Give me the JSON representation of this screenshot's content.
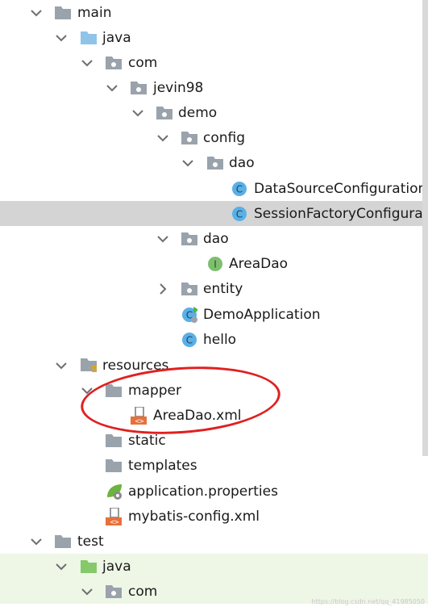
{
  "tree": {
    "nodes": [
      {
        "label": "main",
        "icon": "folder-icon",
        "expanded": true
      },
      {
        "label": "java",
        "icon": "source-folder-icon",
        "expanded": true
      },
      {
        "label": "com",
        "icon": "package-icon",
        "expanded": true
      },
      {
        "label": "jevin98",
        "icon": "package-icon",
        "expanded": true
      },
      {
        "label": "demo",
        "icon": "package-icon",
        "expanded": true
      },
      {
        "label": "config",
        "icon": "package-icon",
        "expanded": true
      },
      {
        "label": "dao",
        "icon": "package-icon",
        "expanded": true
      },
      {
        "label": "DataSourceConfiguration",
        "icon": "class-icon"
      },
      {
        "label": "SessionFactoryConfigurati",
        "icon": "class-icon",
        "selected": true
      },
      {
        "label": "dao",
        "icon": "package-icon",
        "expanded": true
      },
      {
        "label": "AreaDao",
        "icon": "interface-icon"
      },
      {
        "label": "entity",
        "icon": "package-icon",
        "expanded": false
      },
      {
        "label": "DemoApplication",
        "icon": "spring-boot-class-icon"
      },
      {
        "label": "hello",
        "icon": "class-icon"
      },
      {
        "label": "resources",
        "icon": "resources-folder-icon",
        "expanded": true
      },
      {
        "label": "mapper",
        "icon": "folder-icon",
        "expanded": true
      },
      {
        "label": "AreaDao.xml",
        "icon": "xml-file-icon"
      },
      {
        "label": "static",
        "icon": "folder-icon"
      },
      {
        "label": "templates",
        "icon": "folder-icon"
      },
      {
        "label": "application.properties",
        "icon": "spring-properties-icon"
      },
      {
        "label": "mybatis-config.xml",
        "icon": "xml-file-icon"
      },
      {
        "label": "test",
        "icon": "folder-icon",
        "expanded": true
      },
      {
        "label": "java",
        "icon": "test-source-folder-icon",
        "expanded": true
      },
      {
        "label": "com",
        "icon": "package-icon",
        "expanded": true
      }
    ]
  },
  "watermark": "https://blog.csdn.net/qq_41985050",
  "colors": {
    "selection": "#d4d4d4",
    "annotation": "#e02020",
    "class_icon": "#5ab0e6",
    "interface_icon": "#7dbf6e",
    "folder": "#9aa3ab",
    "source_folder": "#8fc4ea",
    "test_folder": "#86c96a"
  }
}
